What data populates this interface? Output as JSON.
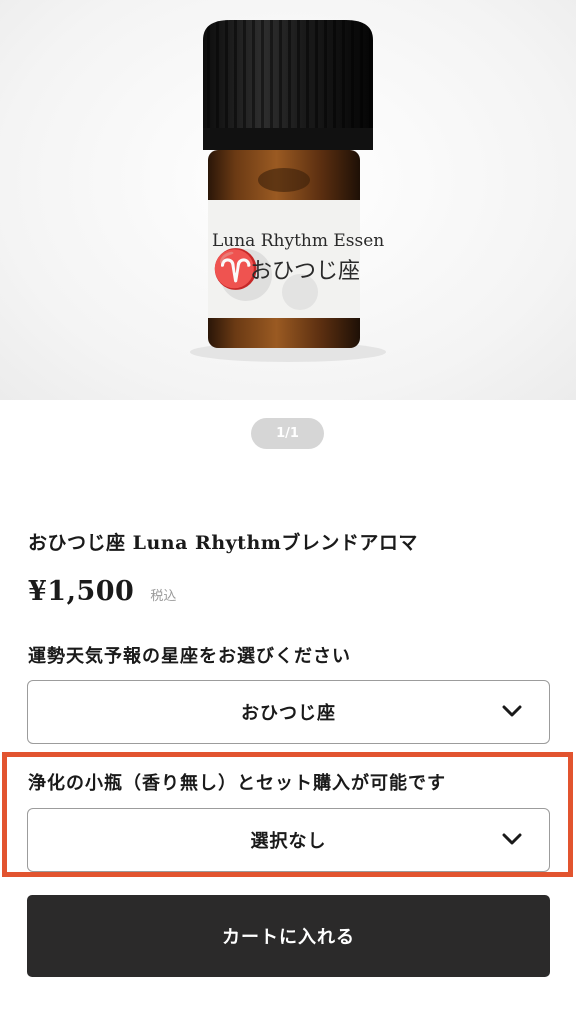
{
  "gallery": {
    "label_text": "Luna Rhythm Essen",
    "label_subtext": "おひつじ座",
    "zodiac_symbol": "♈",
    "pager": "1/1"
  },
  "product": {
    "title": "おひつじ座 Luna Rhythmブレンドアロマ",
    "price": "¥1,500",
    "tax_note": "税込"
  },
  "options": {
    "zodiac_label": "運勢天気予報の星座をお選びください",
    "zodiac_selected": "おひつじ座",
    "bottle_label": "浄化の小瓶（香り無し）とセット購入が可能です",
    "bottle_selected": "選択なし"
  },
  "cart": {
    "button_label": "カートに入れる"
  },
  "colors": {
    "highlight": "#e2542f",
    "button_bg": "#2b2a2a",
    "pager_bg": "#d6d6d6"
  },
  "icons": {
    "dropdown": "chevron-down-icon"
  }
}
